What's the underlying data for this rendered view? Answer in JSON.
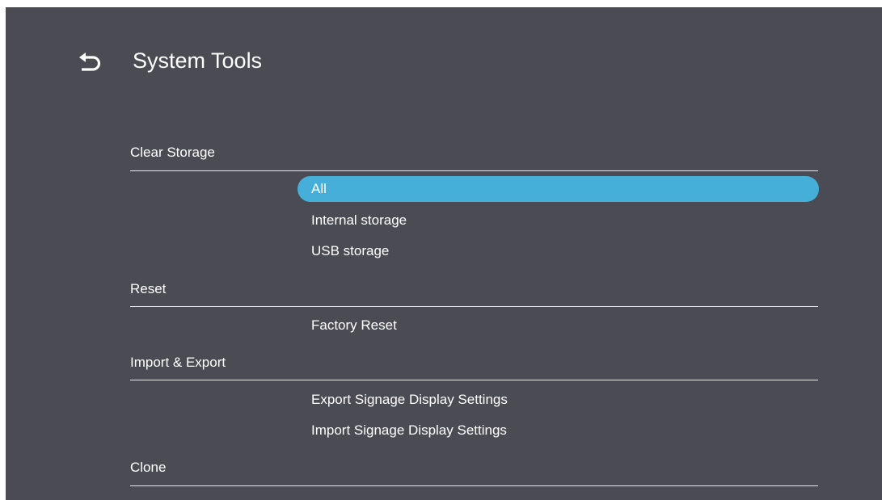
{
  "header": {
    "back_icon": "back-arrow-icon",
    "title": "System Tools"
  },
  "colors": {
    "background": "#4b4b53",
    "selection": "#45afd9",
    "text": "#ffffff",
    "divider": "#e8e8ec"
  },
  "sections": [
    {
      "title": "Clear Storage",
      "options": [
        {
          "label": "All",
          "selected": true
        },
        {
          "label": "Internal storage",
          "selected": false
        },
        {
          "label": "USB storage",
          "selected": false
        }
      ]
    },
    {
      "title": "Reset",
      "options": [
        {
          "label": "Factory Reset",
          "selected": false
        }
      ]
    },
    {
      "title": "Import & Export",
      "options": [
        {
          "label": "Export Signage Display Settings",
          "selected": false
        },
        {
          "label": "Import Signage Display Settings",
          "selected": false
        }
      ]
    },
    {
      "title": "Clone",
      "options": []
    }
  ]
}
